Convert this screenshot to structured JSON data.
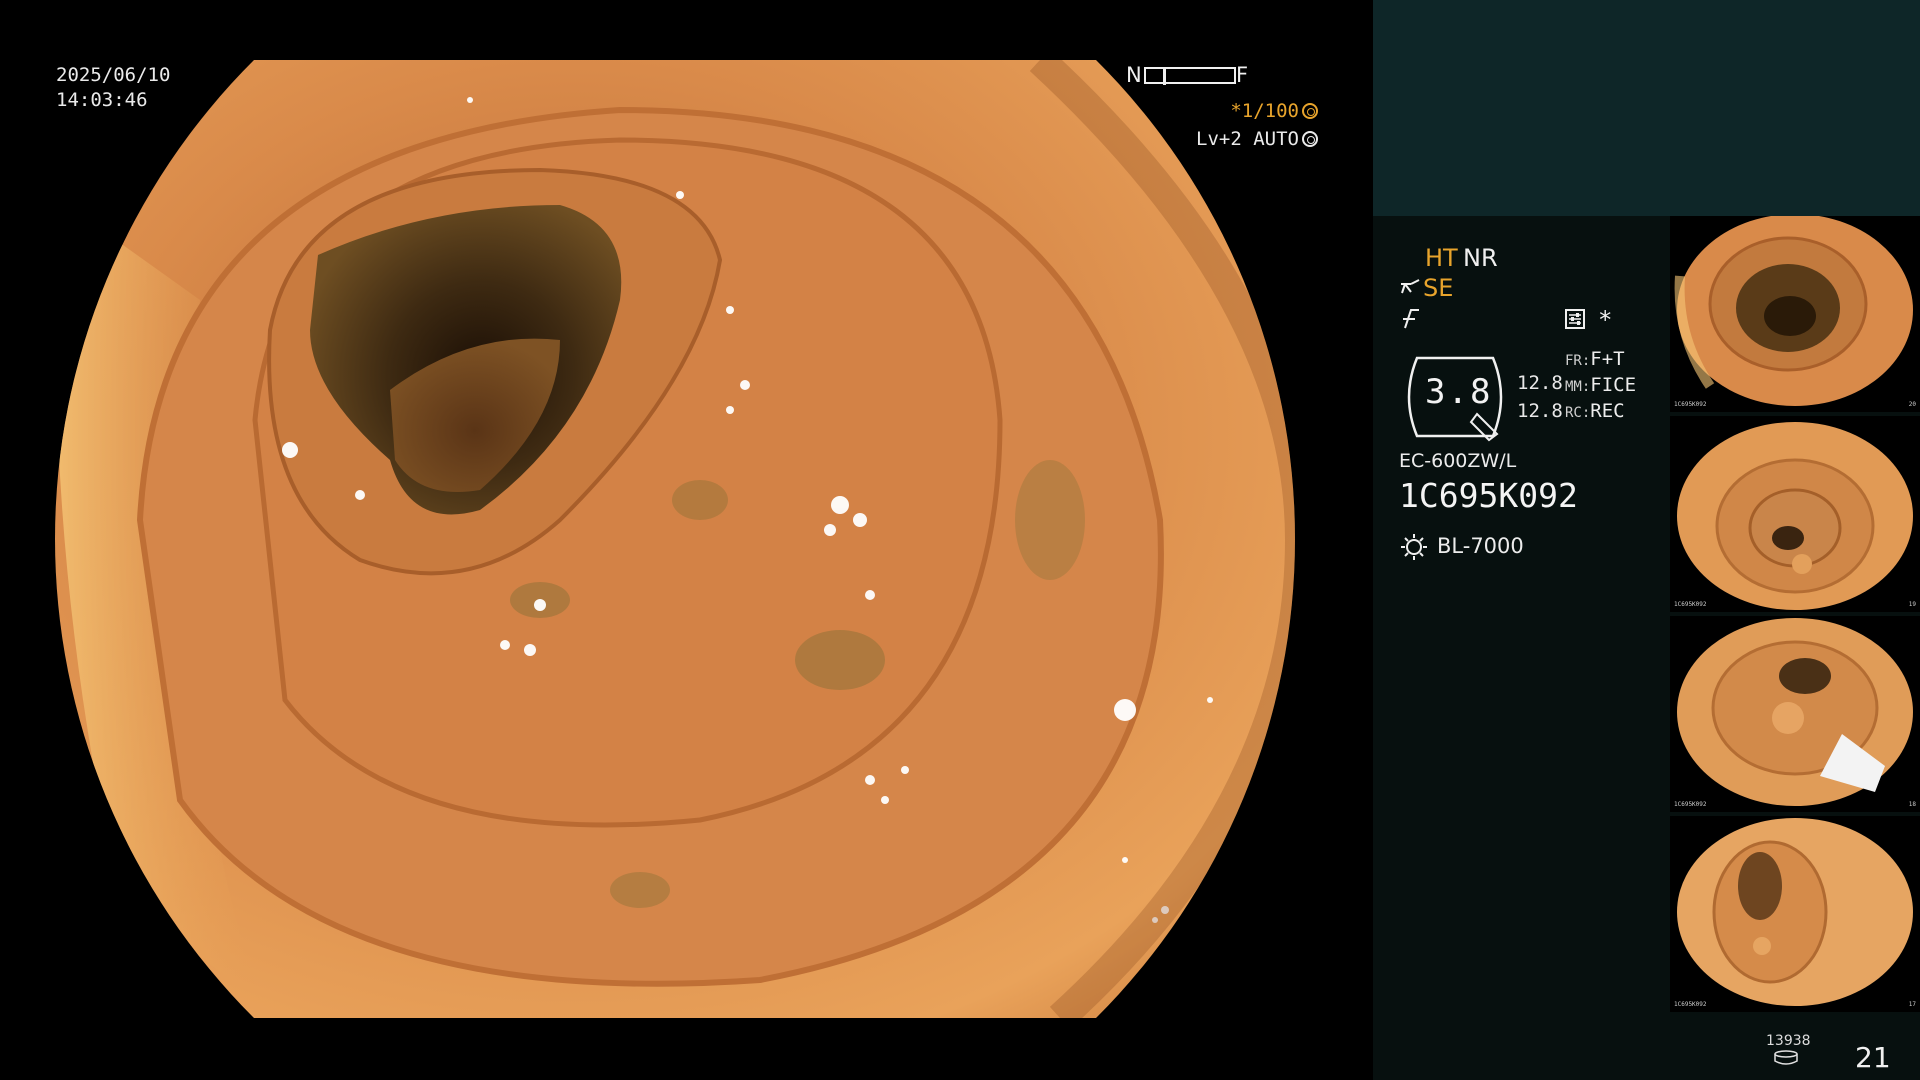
{
  "overlay": {
    "date": "2025/06/10",
    "time": "14:03:46",
    "scale_left": "N",
    "scale_right": "F",
    "shutter": "*1/100",
    "level": "Lv+2 AUTO"
  },
  "panel": {
    "ht": "HT",
    "nr": "NR",
    "se": "SE",
    "star": "*",
    "zoom": "3.8",
    "value_1": "12.8",
    "value_2": "12.8",
    "fr_key": "FR:",
    "fr_value": "F+T",
    "mm_key": "MM:",
    "mm_value": "FICE",
    "rc_key": "RC:",
    "rc_value": "REC",
    "scope_model": "EC-600ZW/L",
    "scope_serial": "1C695K092",
    "light_source": "BL-7000",
    "storage_count": "13938",
    "image_count": "21"
  },
  "thumbnails": [
    {
      "id": "1",
      "serial": "1C695K092",
      "corner": "20"
    },
    {
      "id": "2",
      "serial": "1C695K092",
      "corner": "19"
    },
    {
      "id": "3",
      "serial": "1C695K092",
      "corner": "18"
    },
    {
      "id": "4",
      "serial": "1C695K092",
      "corner": "17"
    }
  ],
  "colors": {
    "accent_orange": "#e8a42c",
    "panel_top": "#0e2628",
    "panel_bg": "#07100f",
    "mucosa": "#d9803f"
  },
  "icons": [
    "settings-icon",
    "light-source-icon",
    "storage-icon",
    "structure-enhance-icon",
    "aperture-icon"
  ]
}
